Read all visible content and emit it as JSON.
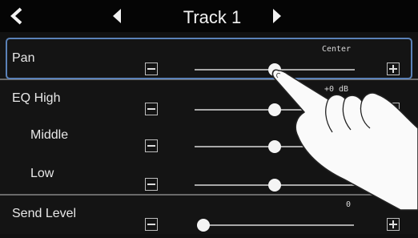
{
  "header": {
    "title": "Track 1",
    "back_icon": "back-chevron-icon",
    "prev_icon": "prev-track-triangle-icon",
    "next_icon": "next-track-triangle-icon"
  },
  "params": [
    {
      "label": "Pan",
      "value_text": "Center",
      "level": 0.5
    },
    {
      "label": "EQ High",
      "value_text": "+0 dB",
      "level": 0.5
    },
    {
      "label": "Middle",
      "value_text": "",
      "level": 0.5
    },
    {
      "label": "Low",
      "value_text": "",
      "level": 0.5
    },
    {
      "label": "Send Level",
      "value_text": "0",
      "level": 0.0
    }
  ],
  "colors": {
    "highlight": "#5b82b8",
    "background": "#111111"
  }
}
